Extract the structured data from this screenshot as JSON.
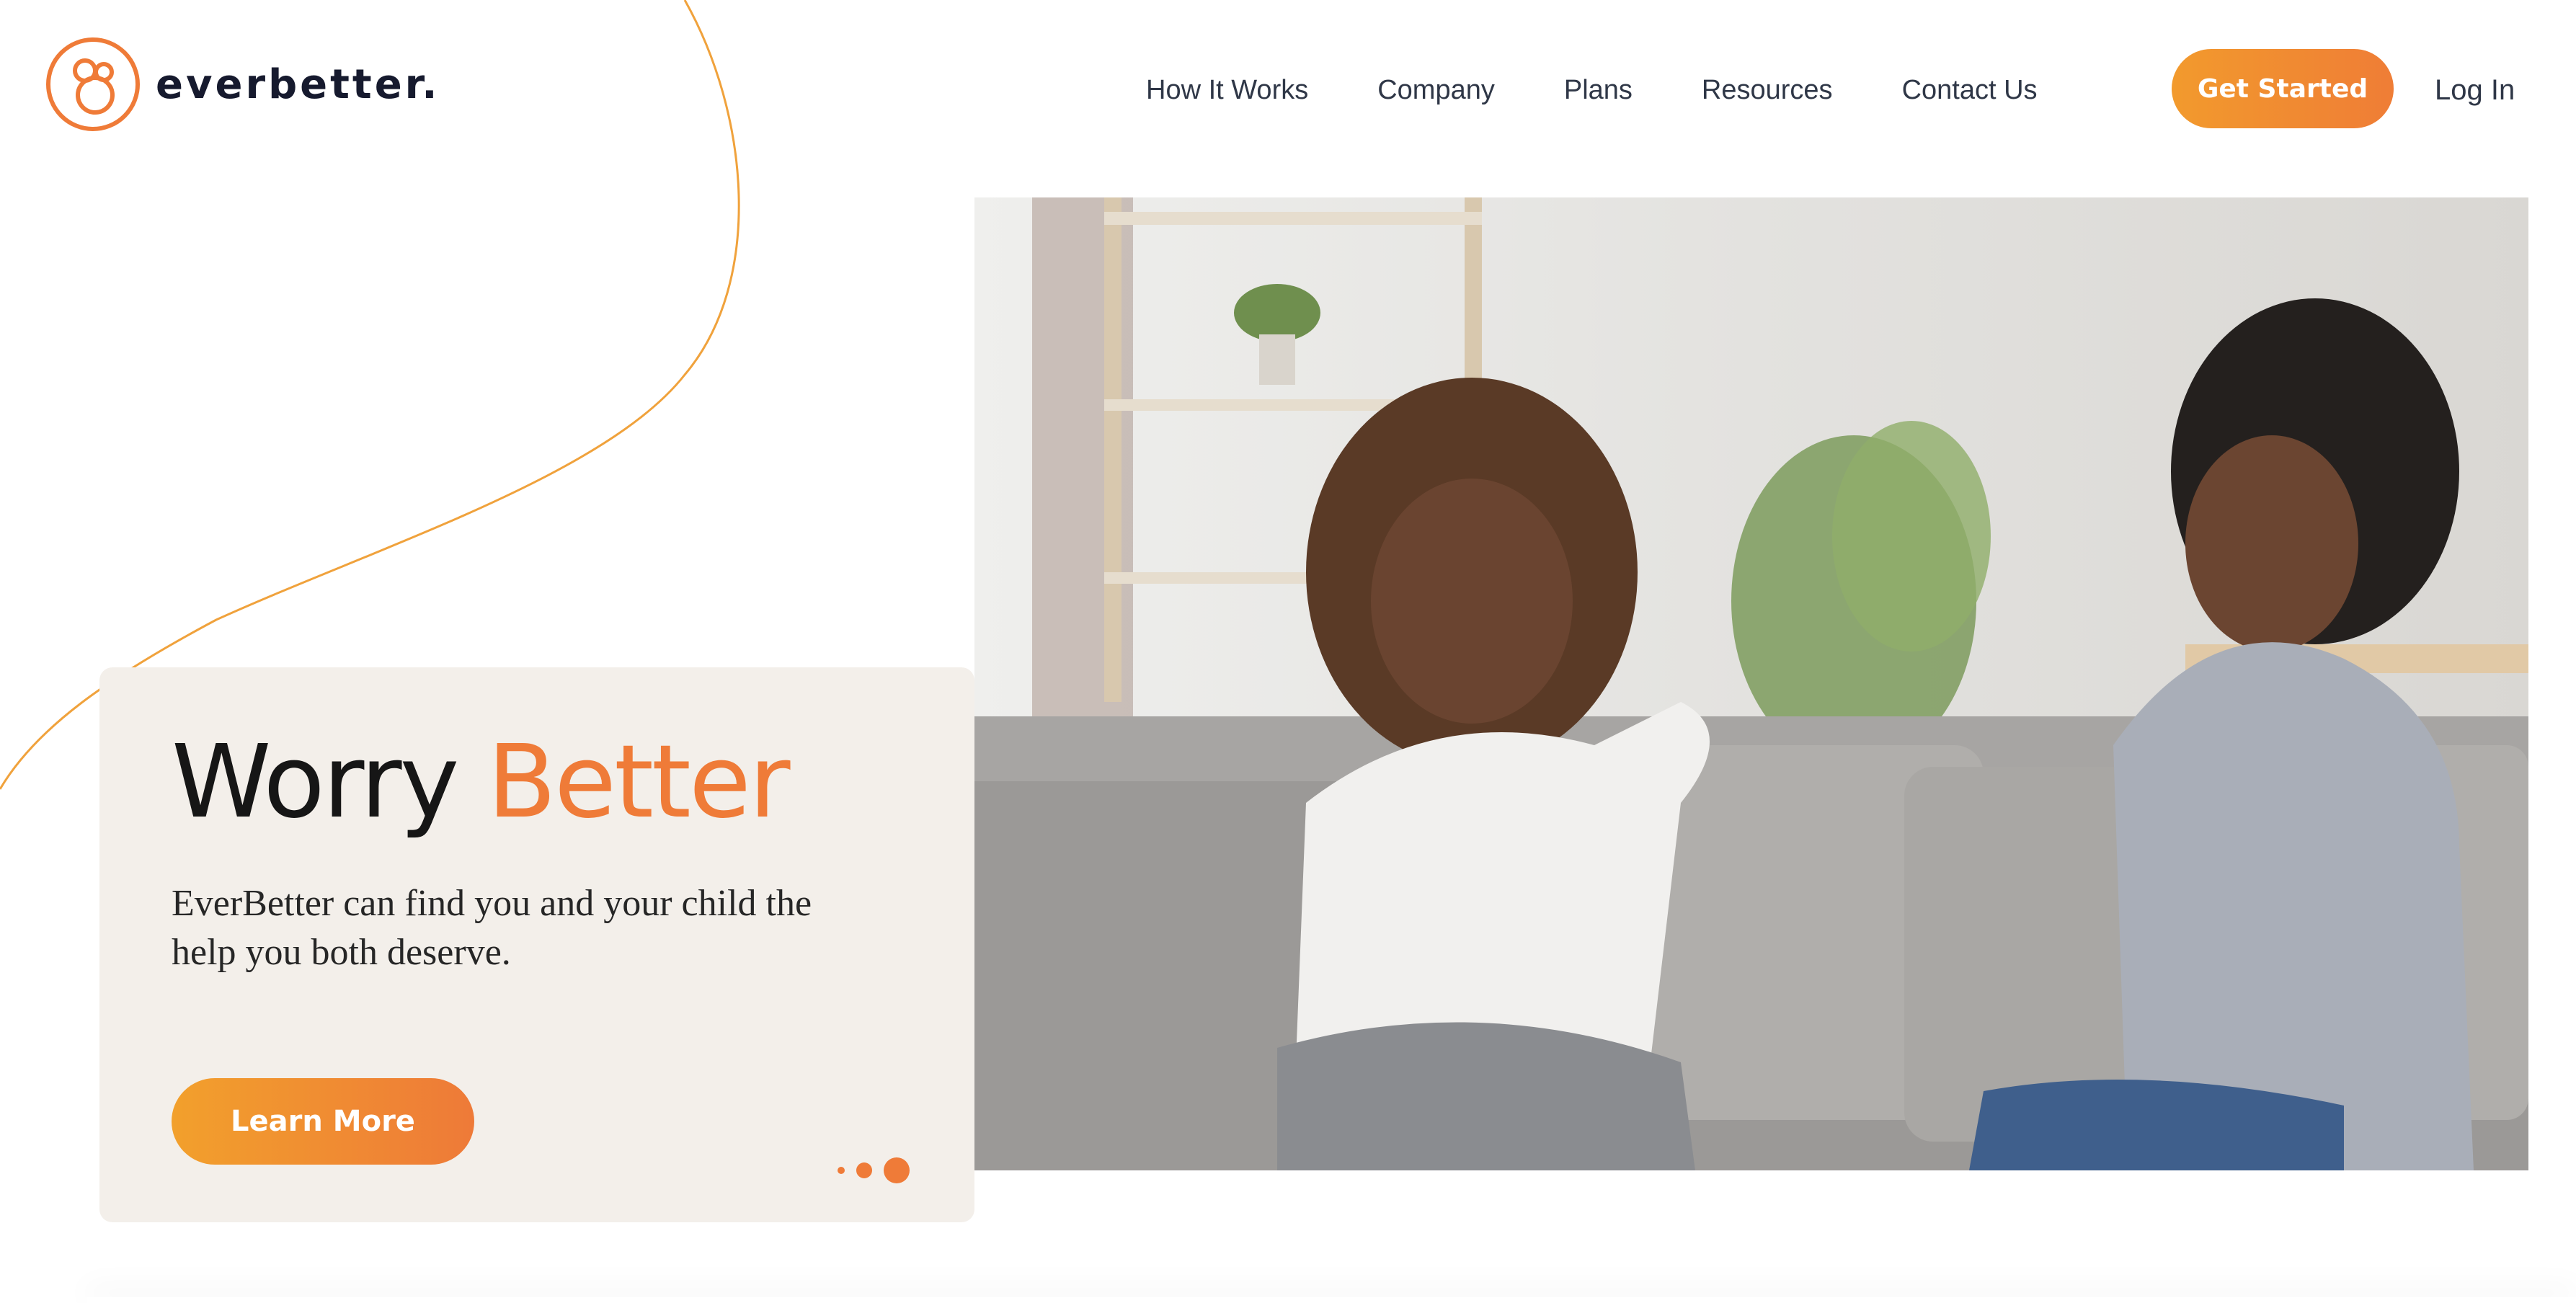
{
  "brand": {
    "name": "everbetter.",
    "logo_icon": "everbetter-logo-icon",
    "accent_color": "#EF7B38",
    "accent_gradient_start": "#F29A2D"
  },
  "nav": {
    "items": [
      {
        "label": "How It Works"
      },
      {
        "label": "Company"
      },
      {
        "label": "Plans"
      },
      {
        "label": "Resources"
      },
      {
        "label": "Contact Us"
      }
    ],
    "cta_label": "Get Started",
    "login_label": "Log In"
  },
  "hero": {
    "title_word_1": "Worry",
    "title_word_2": "Better",
    "subtitle": "EverBetter can find you and your child the help you both deserve.",
    "button_label": "Learn More",
    "image_icon": "hero-photo-two-people-talking-on-couch",
    "carousel": {
      "slide_count": 3,
      "active_index": 2
    }
  }
}
